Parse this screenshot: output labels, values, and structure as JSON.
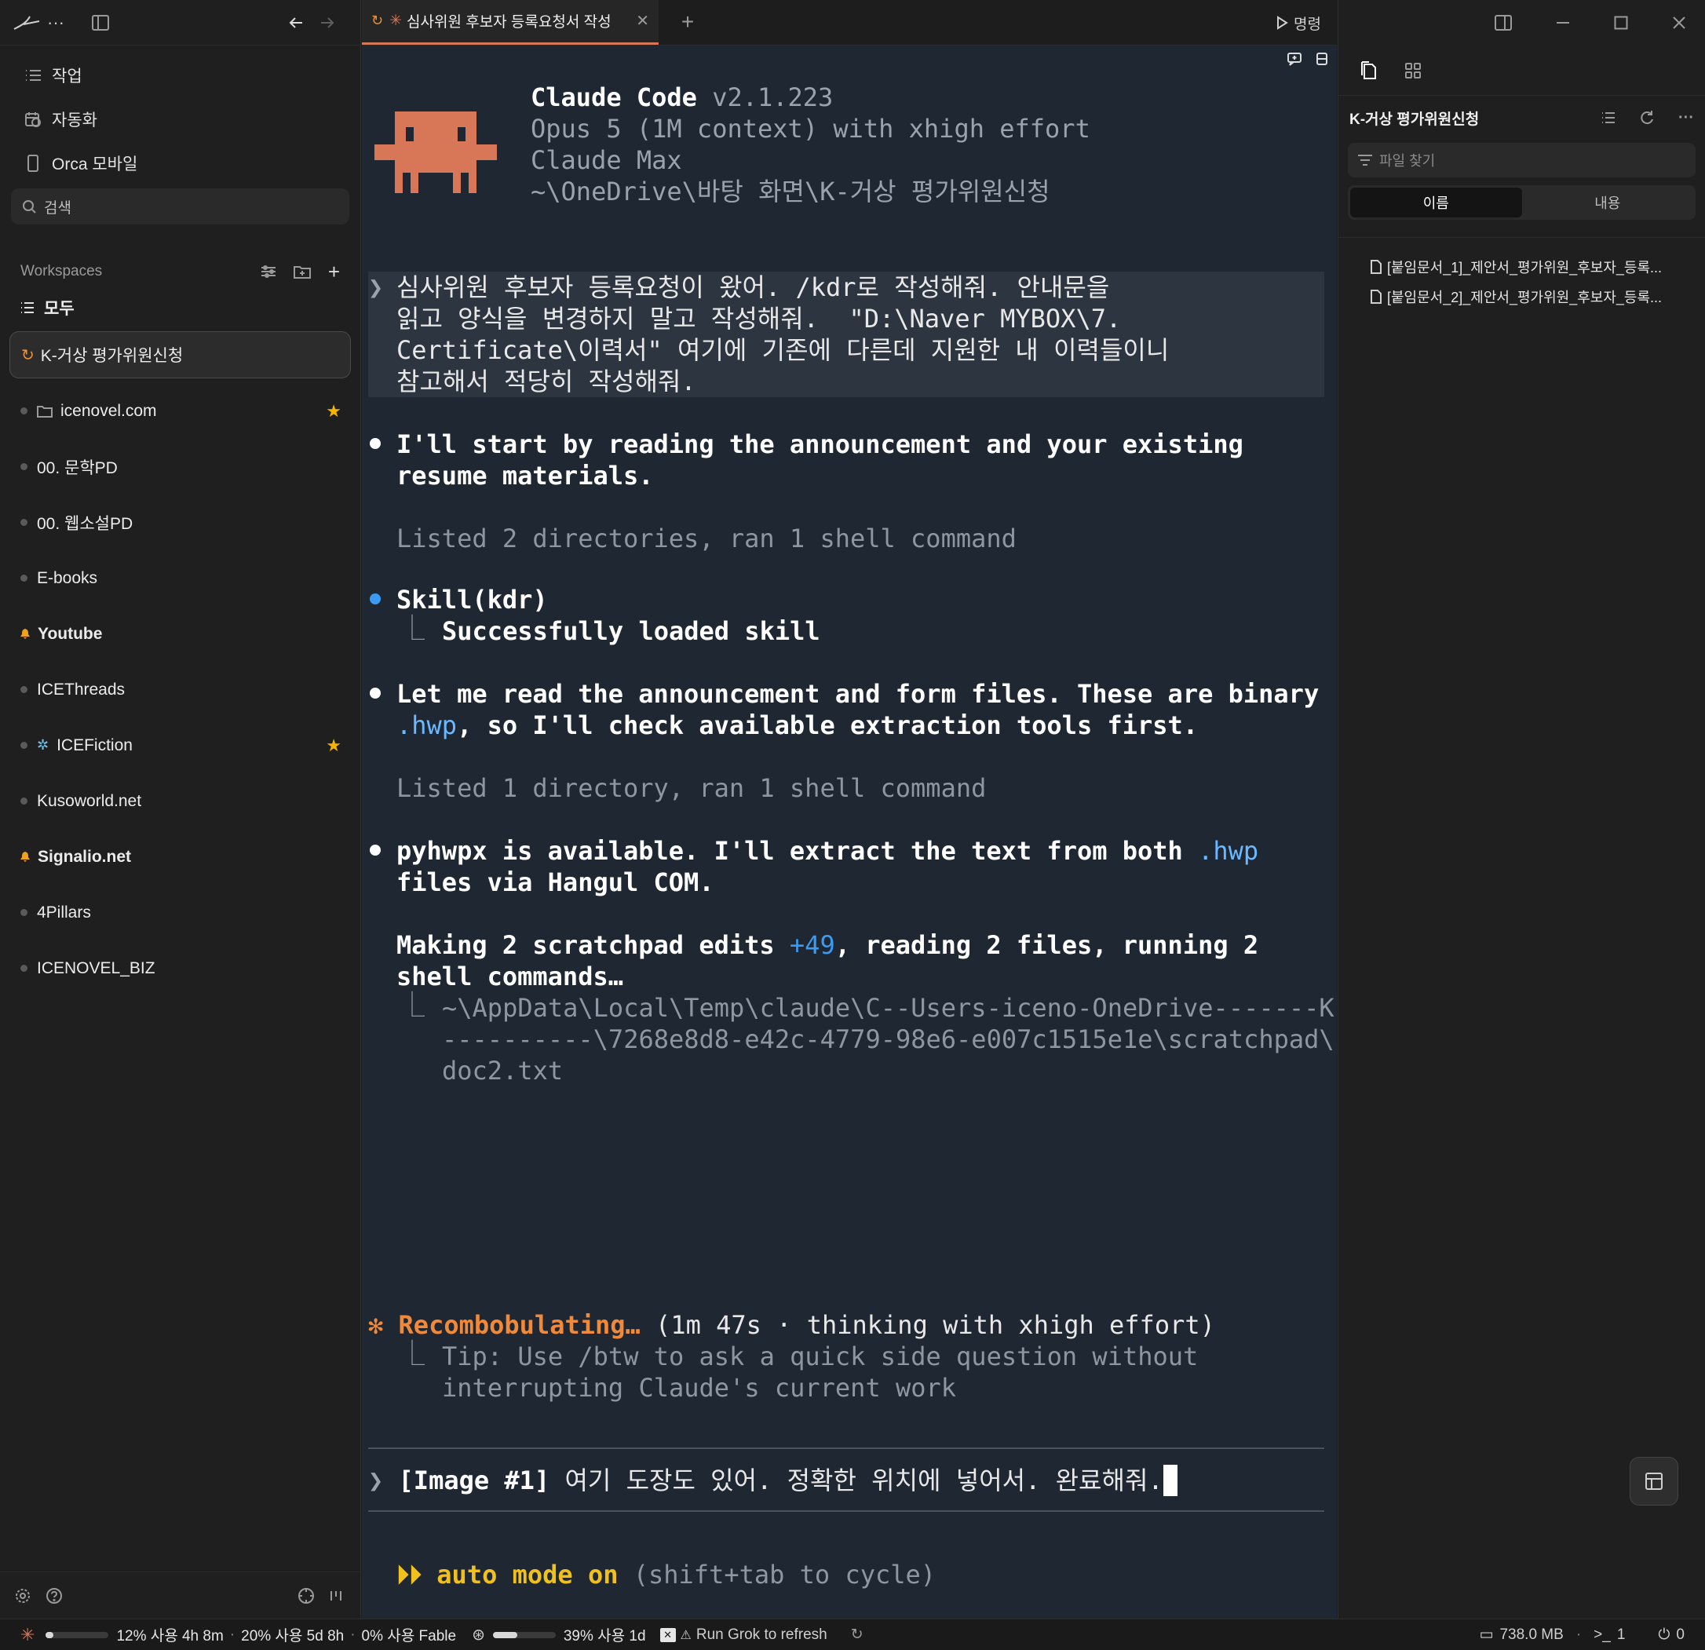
{
  "sidebar": {
    "nav": [
      {
        "label": "작업",
        "icon": "list-icon"
      },
      {
        "label": "자동화",
        "icon": "calendar-clock-icon"
      },
      {
        "label": "Orca 모바일",
        "icon": "phone-icon"
      }
    ],
    "search_label": "검색",
    "workspaces_title": "Workspaces",
    "all_label": "모두",
    "workspaces": [
      {
        "label": "K-거상 평가위원신청",
        "status": "active"
      },
      {
        "label": "icenovel.com",
        "starred": true,
        "folder": true
      },
      {
        "label": "00. 문학PD"
      },
      {
        "label": "00. 웹소설PD"
      },
      {
        "label": "E-books"
      },
      {
        "label": "Youtube",
        "notify": true
      },
      {
        "label": "ICEThreads"
      },
      {
        "label": "ICEFiction",
        "starred": true,
        "app_icon": true
      },
      {
        "label": "Kusoworld.net"
      },
      {
        "label": "Signalio.net",
        "notify": true
      },
      {
        "label": "4Pillars"
      },
      {
        "label": "ICENOVEL_BIZ"
      }
    ]
  },
  "tab": {
    "title": "심사위원 후보자 등록요청서 작성",
    "run_label": "명령"
  },
  "terminal": {
    "app_name": "Claude Code",
    "version": "v2.1.223",
    "model_line": "Opus 5 (1M context) with xhigh effort",
    "plan": "Claude Max",
    "cwd": "~\\OneDrive\\바탕 화면\\K-거상 평가위원신청",
    "user_prompt": [
      "심사위원 후보자 등록요청이 왔어. /kdr로 작성해줘. 안내문을",
      "읽고 양식을 변경하지 말고 작성해줘.  \"D:\\Naver MYBOX\\7.",
      "Certificate\\이력서\" 여기에 기존에 다른데 지원한 내 이력들이니",
      "참고해서 적당히 작성해줘."
    ],
    "msg1": [
      "I'll start by reading the announcement and your existing",
      "resume materials."
    ],
    "tool1": "Listed 2 directories, ran 1 shell command",
    "skill_call": "Skill(kdr)",
    "skill_result": "Successfully loaded skill",
    "msg2_a": "Let me read the announcement and form files. These are binary",
    "msg2_ext": ".hwp",
    "msg2_b": ", so I'll check available extraction tools first.",
    "tool2": "Listed 1 directory, ran 1 shell command",
    "msg3_a": "pyhwpx is available. I'll extract the text from both ",
    "msg3_ext": ".hwp",
    "msg3_b": "files via Hangul COM.",
    "progress_a": "Making 2 scratchpad edits ",
    "progress_plus": "+49",
    "progress_b": ", reading 2 files, running 2",
    "progress_c": "shell commands…",
    "path_lines": [
      "~\\AppData\\Local\\Temp\\claude\\C--Users-iceno-OneDrive-------K",
      "----------\\7268e8d8-e42c-4779-98e6-e007c1515e1e\\scratchpad\\",
      "doc2.txt"
    ],
    "spinner_word": "Recombobulating…",
    "spinner_info": "(1m 47s · thinking with xhigh effort)",
    "tip_lines": [
      "Tip: Use /btw to ask a quick side question without",
      "interrupting Claude's current work"
    ],
    "input_tag": "[Image #1]",
    "input_text": "여기 도장도 있어. 정확한 위치에 넣어서. 완료해줘.",
    "mode_label": "auto mode on",
    "mode_hint": "(shift+tab to cycle)"
  },
  "right_panel": {
    "title": "K-거상 평가위원신청",
    "file_search_placeholder": "파일 찾기",
    "segment_name": "이름",
    "segment_content": "내용",
    "files": [
      "[붙임문서_1]_제안서_평가위원_후보자_등록...",
      "[붙임문서_2]_제안서_평가위원_후보자_등록..."
    ]
  },
  "status_bar": {
    "usage1": "12% 사용 4h 8m",
    "usage1_fraction": 0.12,
    "usage2": "20% 사용 5d 8h",
    "usage3": "0% 사용 Fable",
    "usage4": "39% 사용 1d",
    "usage4_fraction": 0.39,
    "grok": "Run Grok to refresh",
    "memory": "738.0 MB",
    "terminals": "1",
    "ports": "0"
  },
  "colors": {
    "accent": "#d77757",
    "spinner": "#f08a3a",
    "terminal_bg": "#1f2733",
    "link_blue": "#6ab8ff",
    "mode_yellow": "#f0c020"
  }
}
